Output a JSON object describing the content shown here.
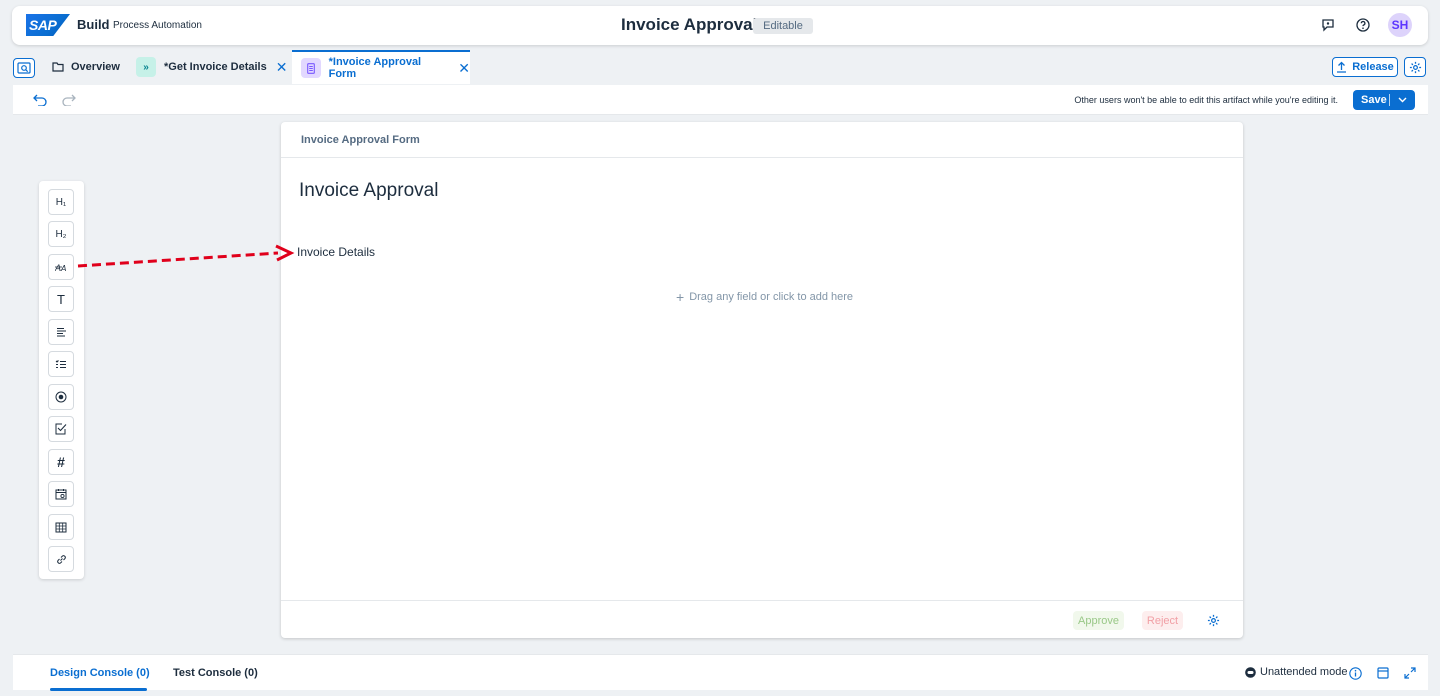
{
  "shell": {
    "logo_text": "SAP",
    "brand": "Build",
    "product": "Process Automation",
    "title": "Invoice Approval",
    "status_badge": "Editable",
    "user_initials": "SH"
  },
  "tabs": [
    {
      "label": "Overview"
    },
    {
      "label": "*Get Invoice Details"
    },
    {
      "label": "*Invoice Approval Form"
    }
  ],
  "actions": {
    "release_label": "Release"
  },
  "toolbar": {
    "note": "Other users won't be able to edit this artifact while you're editing it.",
    "save_label": "Save"
  },
  "palette": {
    "items": [
      {
        "name": "heading-1",
        "glyph": "H₁"
      },
      {
        "name": "heading-2",
        "glyph": "H₂"
      },
      {
        "name": "paragraph",
        "glyph": "A"
      },
      {
        "name": "text-field",
        "glyph": "T"
      },
      {
        "name": "text-area",
        "glyph": ""
      },
      {
        "name": "dropdown",
        "glyph": ""
      },
      {
        "name": "radio-button",
        "glyph": ""
      },
      {
        "name": "checkbox",
        "glyph": ""
      },
      {
        "name": "number",
        "glyph": "#"
      },
      {
        "name": "date",
        "glyph": ""
      },
      {
        "name": "table",
        "glyph": ""
      },
      {
        "name": "link",
        "glyph": ""
      }
    ]
  },
  "form": {
    "header": "Invoice Approval Form",
    "heading": "Invoice Approval",
    "subheading": "Invoice Details",
    "drop_hint": "Drag any field or click to add here",
    "approve_label": "Approve",
    "reject_label": "Reject"
  },
  "console": {
    "design_tab": "Design Console (0)",
    "test_tab": "Test Console (0)",
    "mode_label": "Unattended mode"
  },
  "colors": {
    "accent": "#0a6ed1",
    "annotation_arrow": "#e0001b"
  }
}
